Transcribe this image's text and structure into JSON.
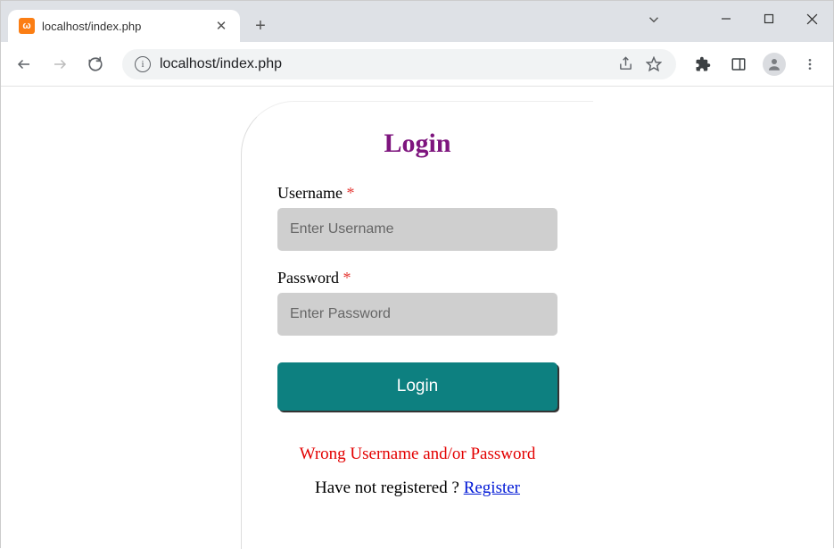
{
  "browser": {
    "tab_title": "localhost/index.php",
    "url": "localhost/index.php"
  },
  "page": {
    "title": "Login",
    "username_label": "Username",
    "password_label": "Password",
    "required_mark": "*",
    "username_placeholder": "Enter Username",
    "password_placeholder": "Enter Password",
    "submit_label": "Login",
    "error_message": "Wrong Username and/or Password",
    "register_prompt": "Have not registered ? ",
    "register_link": "Register"
  }
}
